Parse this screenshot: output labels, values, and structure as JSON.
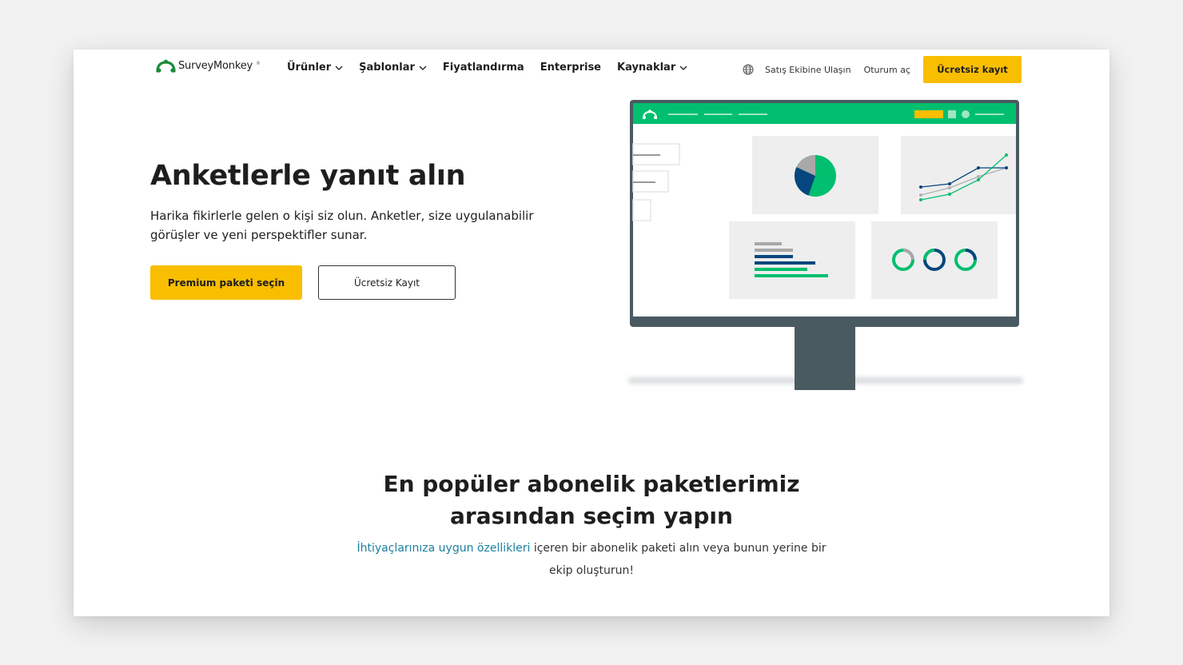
{
  "nav": {
    "logo_text": "SurveyMonkey",
    "logo_tm": "®",
    "menu": [
      {
        "label": "Ürünler",
        "dropdown": true
      },
      {
        "label": "Şablonlar",
        "dropdown": true
      },
      {
        "label": "Fiyatlandırma",
        "dropdown": false
      },
      {
        "label": "Enterprise",
        "dropdown": false
      },
      {
        "label": "Kaynaklar",
        "dropdown": true
      }
    ],
    "globe_icon": "globe-icon",
    "sales_link": "Satış Ekibine Ulaşın",
    "login_link": "Oturum aç",
    "signup_button": "Ücretsiz kayıt"
  },
  "hero": {
    "title": "Anketlerle yanıt alın",
    "subtitle": "Harika fikirlerle gelen o kişi siz olun. Anketler, size uygulanabilir görüşler ve yeni perspektifler sunar.",
    "primary_button": "Premium paketi seçin",
    "secondary_button": "Ücretsiz Kayıt"
  },
  "section": {
    "title_line1": "En popüler abonelik paketlerimiz",
    "title_line2": "arasından seçim yapın",
    "sub_link": "İhtiyaçlarınıza uygun özellikleri",
    "sub_rest": " içeren bir abonelik paketi alın veya bunun yerine bir ekip oluşturun!"
  },
  "colors": {
    "accent_yellow": "#f9be00",
    "brand_green": "#00bf6f",
    "navy": "#05467e",
    "monitor_frame": "#4a5a61",
    "link_blue": "#1b7fa0"
  }
}
